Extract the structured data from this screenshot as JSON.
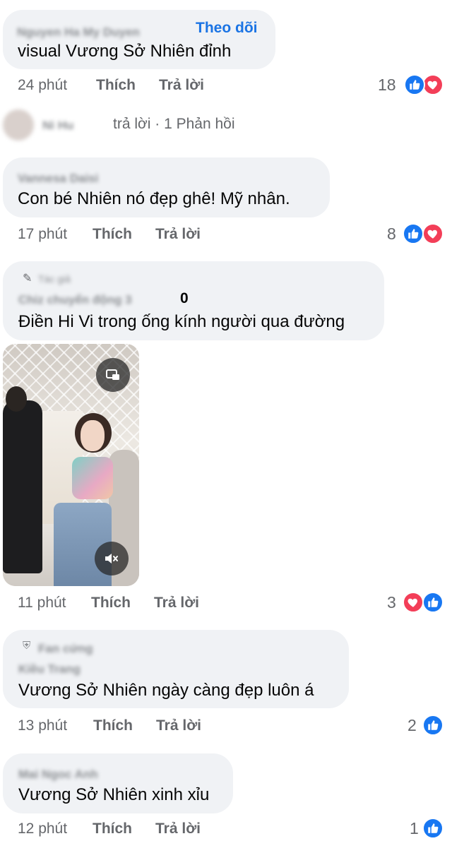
{
  "comments": [
    {
      "author": "Nguyen Ha My Duyen",
      "follow_label": "Theo dõi",
      "text": "visual Vương Sở Nhiên đỉnh",
      "time": "24 phút",
      "like_label": "Thích",
      "reply_label": "Trả lời",
      "reaction_count": "18",
      "reactions": [
        "like-icon",
        "love-icon"
      ]
    },
    {
      "author": "Vannesa Daisi",
      "text": "Con bé Nhiên nó đẹp ghê! Mỹ nhân.",
      "time": "17 phút",
      "like_label": "Thích",
      "reply_label": "Trả lời",
      "reaction_count": "8",
      "reactions": [
        "like-icon",
        "love-icon"
      ]
    },
    {
      "badge": "Tác giả",
      "author": "Chiz chuyển động 3",
      "author_suffix": "0",
      "text": "Điền Hi Vi trong ống kính người qua đường",
      "time": "11 phút",
      "like_label": "Thích",
      "reply_label": "Trả lời",
      "reaction_count": "3",
      "reactions": [
        "love-icon",
        "like-icon"
      ]
    },
    {
      "author_line1": "Fan cứng",
      "author": "Kiều Trang",
      "text": "Vương Sở Nhiên ngày càng đẹp luôn á",
      "time": "13 phút",
      "like_label": "Thích",
      "reply_label": "Trả lời",
      "reaction_count": "2",
      "reactions": [
        "like-icon"
      ]
    },
    {
      "author": "Mai Ngoc Anh",
      "text": "Vương Sở Nhiên xinh xỉu",
      "time": "12 phút",
      "like_label": "Thích",
      "reply_label": "Trả lời",
      "reaction_count": "1",
      "reactions": [
        "like-icon"
      ]
    }
  ],
  "reply_summary": {
    "name": "Ni Hu",
    "text": "trả lời · 1 Phản hồi"
  },
  "colors": {
    "like": "#1877f2",
    "love": "#f33e58",
    "link": "#1b74e4",
    "bubble": "#f0f2f5",
    "meta": "#65676b"
  }
}
